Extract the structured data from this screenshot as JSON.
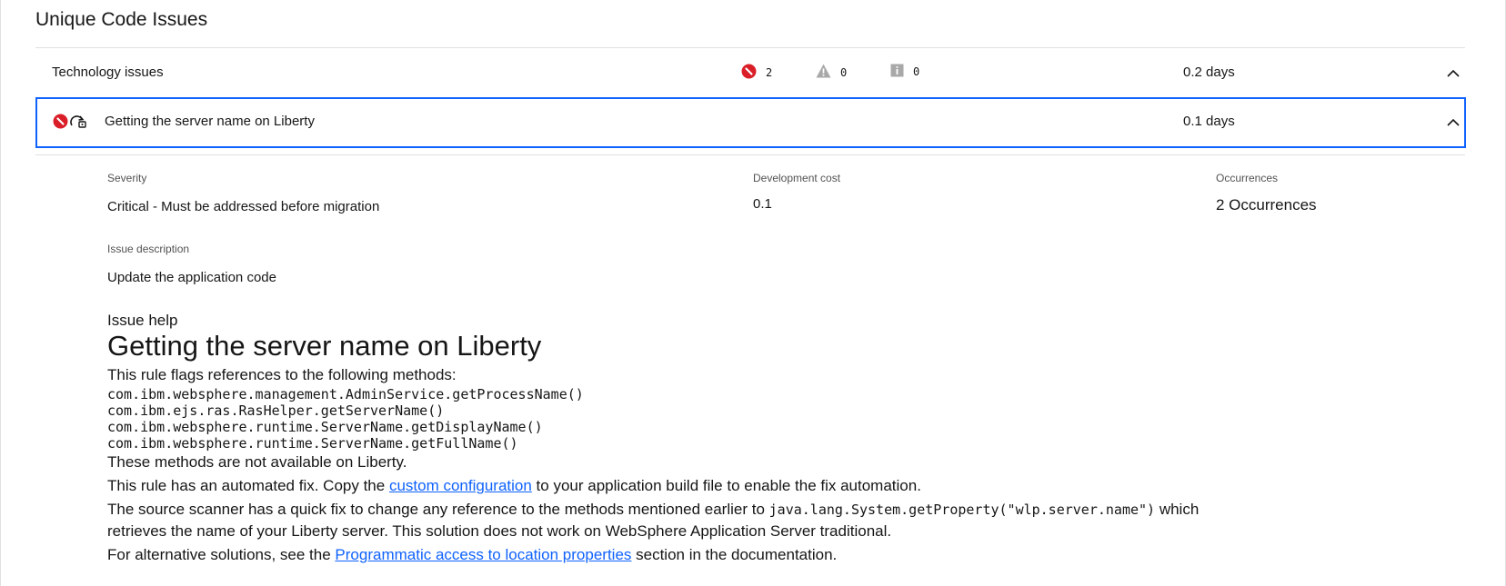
{
  "section": {
    "title": "Unique Code Issues"
  },
  "group": {
    "title": "Technology issues",
    "severity_counts": {
      "critical": "2",
      "warning": "0",
      "info": "0"
    },
    "cost": "0.2 days"
  },
  "issue": {
    "title": "Getting the server name on Liberty",
    "cost": "0.1 days"
  },
  "details": {
    "severity_label": "Severity",
    "severity_value": "Critical - Must be addressed before migration",
    "dev_cost_label": "Development cost",
    "dev_cost_value": "0.1",
    "occurrences_label": "Occurrences",
    "occurrences_value": "2 Occurrences",
    "description_label": "Issue description",
    "description_value": "Update the application code"
  },
  "help": {
    "heading": "Issue help",
    "title": "Getting the server name on Liberty",
    "intro": "This rule flags references to the following methods:",
    "methods": [
      "com.ibm.websphere.management.AdminService.getProcessName()",
      "com.ibm.ejs.ras.RasHelper.getServerName()",
      "com.ibm.websphere.runtime.ServerName.getDisplayName()",
      "com.ibm.websphere.runtime.ServerName.getFullName()"
    ],
    "not_available": "These methods are not available on Liberty.",
    "autofix_before": "This rule has an automated fix. Copy the ",
    "autofix_link": "custom configuration",
    "autofix_after": " to your application build file to enable the fix automation.",
    "quickfix_before": "The source scanner has a quick fix to change any reference to the methods mentioned earlier to ",
    "quickfix_code": "java.lang.System.getProperty(\"wlp.server.name\")",
    "quickfix_after": " which",
    "quickfix_line2": "retrieves the name of your Liberty server. This solution does not work on WebSphere Application Server traditional.",
    "alt_before": "For alternative solutions, see the ",
    "alt_link": "Programmatic access to location properties",
    "alt_after": " section in the documentation."
  },
  "colors": {
    "critical": "#da1e28",
    "accent": "#0f62fe",
    "muted": "#a8a8a8"
  },
  "icons": [
    "critical-icon",
    "warning-icon",
    "info-icon",
    "chevron-up-icon",
    "quick-fix-icon"
  ]
}
